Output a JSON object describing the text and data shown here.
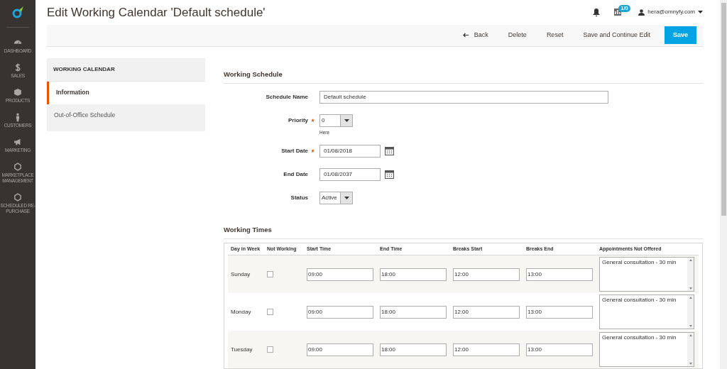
{
  "nav": [
    {
      "label": "DASHBOARD",
      "kind": "gauge"
    },
    {
      "label": "SALES",
      "kind": "dollar"
    },
    {
      "label": "PRODUCTS",
      "kind": "box"
    },
    {
      "label": "CUSTOMERS",
      "kind": "person"
    },
    {
      "label": "MARKETING",
      "kind": "megaphone"
    },
    {
      "label": "MARKETPLACE MANAGEMENT",
      "kind": "hexagon"
    },
    {
      "label": "SCHEDULED RE-PURCHASE",
      "kind": "hexagon"
    }
  ],
  "title": "Edit Working Calendar 'Default schedule'",
  "header": {
    "badge": "1/0",
    "user": "hera@omnyfy.com"
  },
  "actions": [
    {
      "label": "Back",
      "kind": "back"
    },
    {
      "label": "Delete",
      "kind": "plain"
    },
    {
      "label": "Reset",
      "kind": "plain"
    },
    {
      "label": "Save and Continue Edit",
      "kind": "plain"
    },
    {
      "label": "Save",
      "kind": "primary"
    }
  ],
  "side_panel": {
    "title": "WORKING CALENDAR",
    "items": [
      {
        "label": "Information",
        "selected": true
      },
      {
        "label": "Out-of-Office Schedule",
        "selected": false
      }
    ]
  },
  "schedule": {
    "title": "Working Schedule",
    "fields": [
      {
        "label": "Schedule Name",
        "kind": "text",
        "value": "Default schedule",
        "required": false
      },
      {
        "label": "Priority",
        "kind": "select",
        "value": "0",
        "required": true,
        "note": "Here"
      },
      {
        "label": "Start Date",
        "kind": "date",
        "value": "01/08/2018",
        "required": true
      },
      {
        "label": "End Date",
        "kind": "date",
        "value": "01/08/2037",
        "required": false
      },
      {
        "label": "Status",
        "kind": "select",
        "value": "Active",
        "required": false
      }
    ]
  },
  "working_times": {
    "title": "Working Times",
    "columns": [
      "Day in Week",
      "Not Working",
      "Start Time",
      "End Time",
      "Breaks Start",
      "Breaks End",
      "Appointments Not Offered"
    ],
    "rows": [
      {
        "day": "Sunday",
        "not_working": false,
        "start": "09:00",
        "end": "18:00",
        "break_start": "12:00",
        "break_end": "13:00",
        "not_offered": "General consultation - 30 min"
      },
      {
        "day": "Monday",
        "not_working": false,
        "start": "09:00",
        "end": "18:00",
        "break_start": "12:00",
        "break_end": "13:00",
        "not_offered": "General consultation - 30 min"
      },
      {
        "day": "Tuesday",
        "not_working": false,
        "start": "09:00",
        "end": "18:00",
        "break_start": "12:00",
        "break_end": "13:00",
        "not_offered": "General consultation - 30 min"
      }
    ]
  }
}
